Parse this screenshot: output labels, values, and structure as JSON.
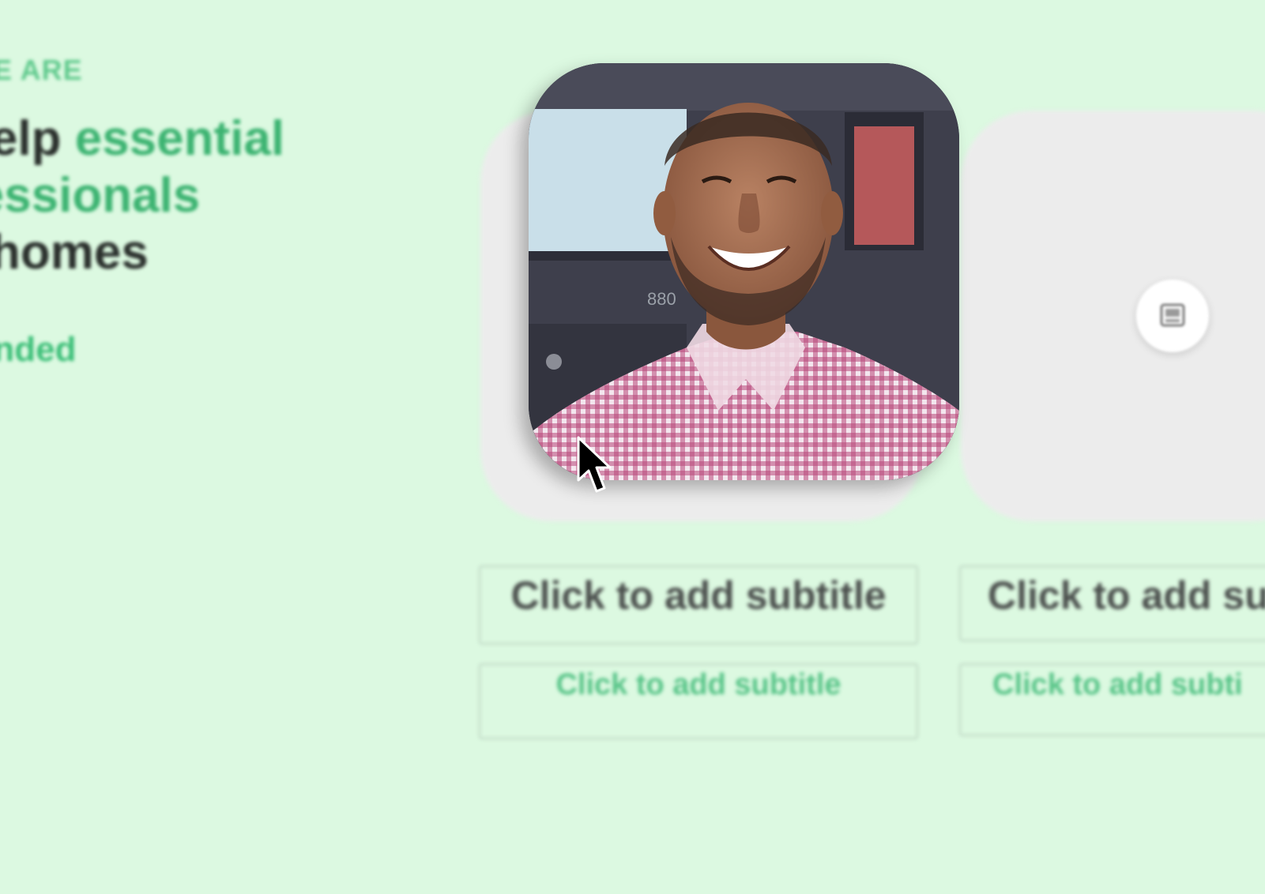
{
  "hero": {
    "eyebrow": "WE ARE",
    "headline_line1_plain": "help ",
    "headline_line1_accent": "essential",
    "headline_line2_accent": "fessionals",
    "headline_line3_plain": "homes",
    "tagline": "Landed"
  },
  "cards": [
    {
      "image": "portrait-photo",
      "subtitle": "Click to add subtitle",
      "description": "Click to add subtitle"
    },
    {
      "image": "image-placeholder-icon",
      "subtitle": "Click to add su",
      "description": "Click to add subti"
    }
  ],
  "colors": {
    "background": "#dcf9e1",
    "accent": "#3cb371",
    "card": "#ececec",
    "text": "#2a2f2c"
  },
  "cursor": "arrow-pointer"
}
